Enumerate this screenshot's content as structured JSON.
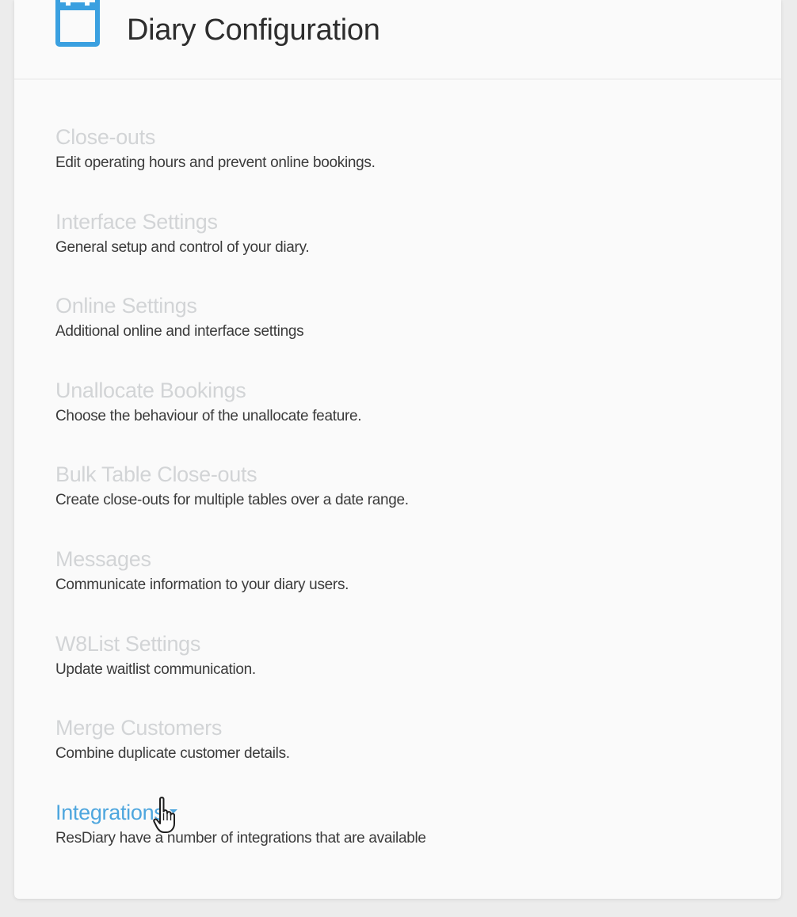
{
  "header": {
    "title": "Diary Configuration",
    "icon": "calendar-icon",
    "accent_color": "#3aa0e0"
  },
  "settings": [
    {
      "title": "Close-outs",
      "description": "Edit operating hours and prevent online bookings."
    },
    {
      "title": "Interface Settings",
      "description": "General setup and control of your diary."
    },
    {
      "title": "Online Settings",
      "description": "Additional online and interface settings"
    },
    {
      "title": "Unallocate Bookings",
      "description": "Choose the behaviour of the unallocate feature."
    },
    {
      "title": "Bulk Table Close-outs",
      "description": "Create close-outs for multiple tables over a date range."
    },
    {
      "title": "Messages",
      "description": "Communicate information to your diary users."
    },
    {
      "title": "W8List Settings",
      "description": "Update waitlist communication."
    },
    {
      "title": "Merge Customers",
      "description": "Combine duplicate customer details."
    },
    {
      "title": "Integrations",
      "description": "ResDiary have a number of integrations that are available",
      "state": "hovered",
      "has_dropdown": true
    }
  ],
  "colors": {
    "link_inactive": "#d2d4d6",
    "link_active": "#4ea6de",
    "description_text": "#3b3b3b"
  },
  "cursor": "hand-pointer-icon"
}
